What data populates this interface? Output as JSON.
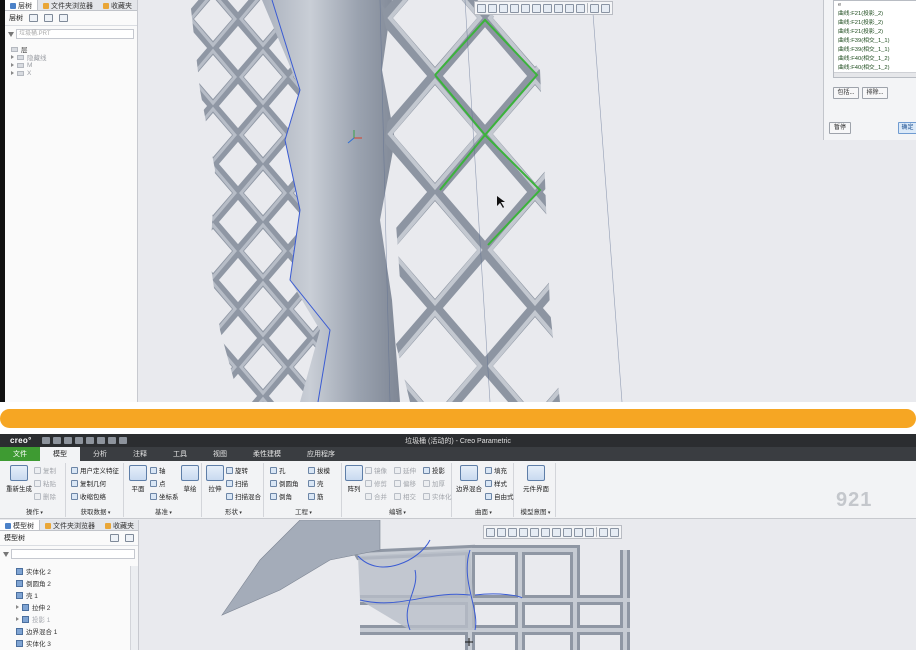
{
  "top": {
    "sidebar": {
      "tabs": [
        {
          "label": "层树"
        },
        {
          "label": "文件夹浏览器"
        },
        {
          "label": "收藏夹"
        }
      ],
      "toolbar_label": "层树",
      "filter_value": "垃圾桶.PRT",
      "tree": [
        {
          "label": "层",
          "state": "expanded"
        },
        {
          "label": "隐藏线"
        },
        {
          "label": "M"
        },
        {
          "label": "X"
        }
      ]
    },
    "dialog": {
      "header": "e",
      "references": [
        "曲线:F21(投影_2)",
        "曲线:F21(投影_2)",
        "曲线:F21(投影_2)",
        "曲线:F39(相交_1_1)",
        "曲线:F39(相交_1_1)",
        "曲线:F40(相交_1_2)",
        "曲线:F40(相交_1_2)"
      ],
      "include_button": "包括...",
      "exclude_button": "排除...",
      "pause_button": "暂停",
      "ok_button": "确定"
    }
  },
  "bottom": {
    "logo": "creo°",
    "window_title": "垃圾桶 (活动的) - Creo Parametric",
    "menu": [
      "文件",
      "模型",
      "分析",
      "注释",
      "工具",
      "视图",
      "柔性建模",
      "应用程序"
    ],
    "ribbon": {
      "groups": [
        {
          "title": "操作",
          "big": "重新生成",
          "items": [
            "复制",
            "粘贴",
            "删除"
          ]
        },
        {
          "title": "获取数据",
          "items": [
            "用户定义特征",
            "复制几何",
            "收缩包络"
          ]
        },
        {
          "title": "基准",
          "big": "平面",
          "items": [
            "轴",
            "点",
            "坐标系"
          ],
          "extra": "草绘"
        },
        {
          "title": "形状",
          "big": "拉伸",
          "items": [
            "旋转",
            "扫描",
            "扫描混合"
          ]
        },
        {
          "title": "工程",
          "items": [
            "孔",
            "倒圆角",
            "倒角",
            "拔模",
            "壳",
            "筋"
          ]
        },
        {
          "title": "编辑",
          "big": "阵列",
          "items": [
            "镜像",
            "延伸",
            "投影",
            "修剪",
            "偏移",
            "加厚",
            "合并",
            "相交",
            "实体化"
          ]
        },
        {
          "title": "曲面",
          "big": "边界混合",
          "items": [
            "填充",
            "样式",
            "自由式"
          ]
        },
        {
          "title": "模型意图",
          "big": "元件界面"
        }
      ]
    },
    "sidebar": {
      "tabs": [
        {
          "label": "模型树"
        },
        {
          "label": "文件夹浏览器"
        },
        {
          "label": "收藏夹"
        }
      ],
      "toolbar_label": "模型树",
      "tree": [
        {
          "label": "实体化 2",
          "dim": false
        },
        {
          "label": "倒圆角 2",
          "dim": false
        },
        {
          "label": "壳 1",
          "dim": false
        },
        {
          "label": "拉伸 2",
          "dim": false
        },
        {
          "label": "投影 1",
          "dim": true
        },
        {
          "label": "边界混合 1",
          "dim": false
        },
        {
          "label": "实体化 3",
          "dim": false
        }
      ]
    },
    "watermark": "921"
  },
  "colors": {
    "divider": "#f6a623",
    "model_gray": "#9aa3b2",
    "highlight_green": "#3bb33b",
    "edge_blue": "#3a5bd3",
    "file_tab_green": "#3e9b32"
  }
}
